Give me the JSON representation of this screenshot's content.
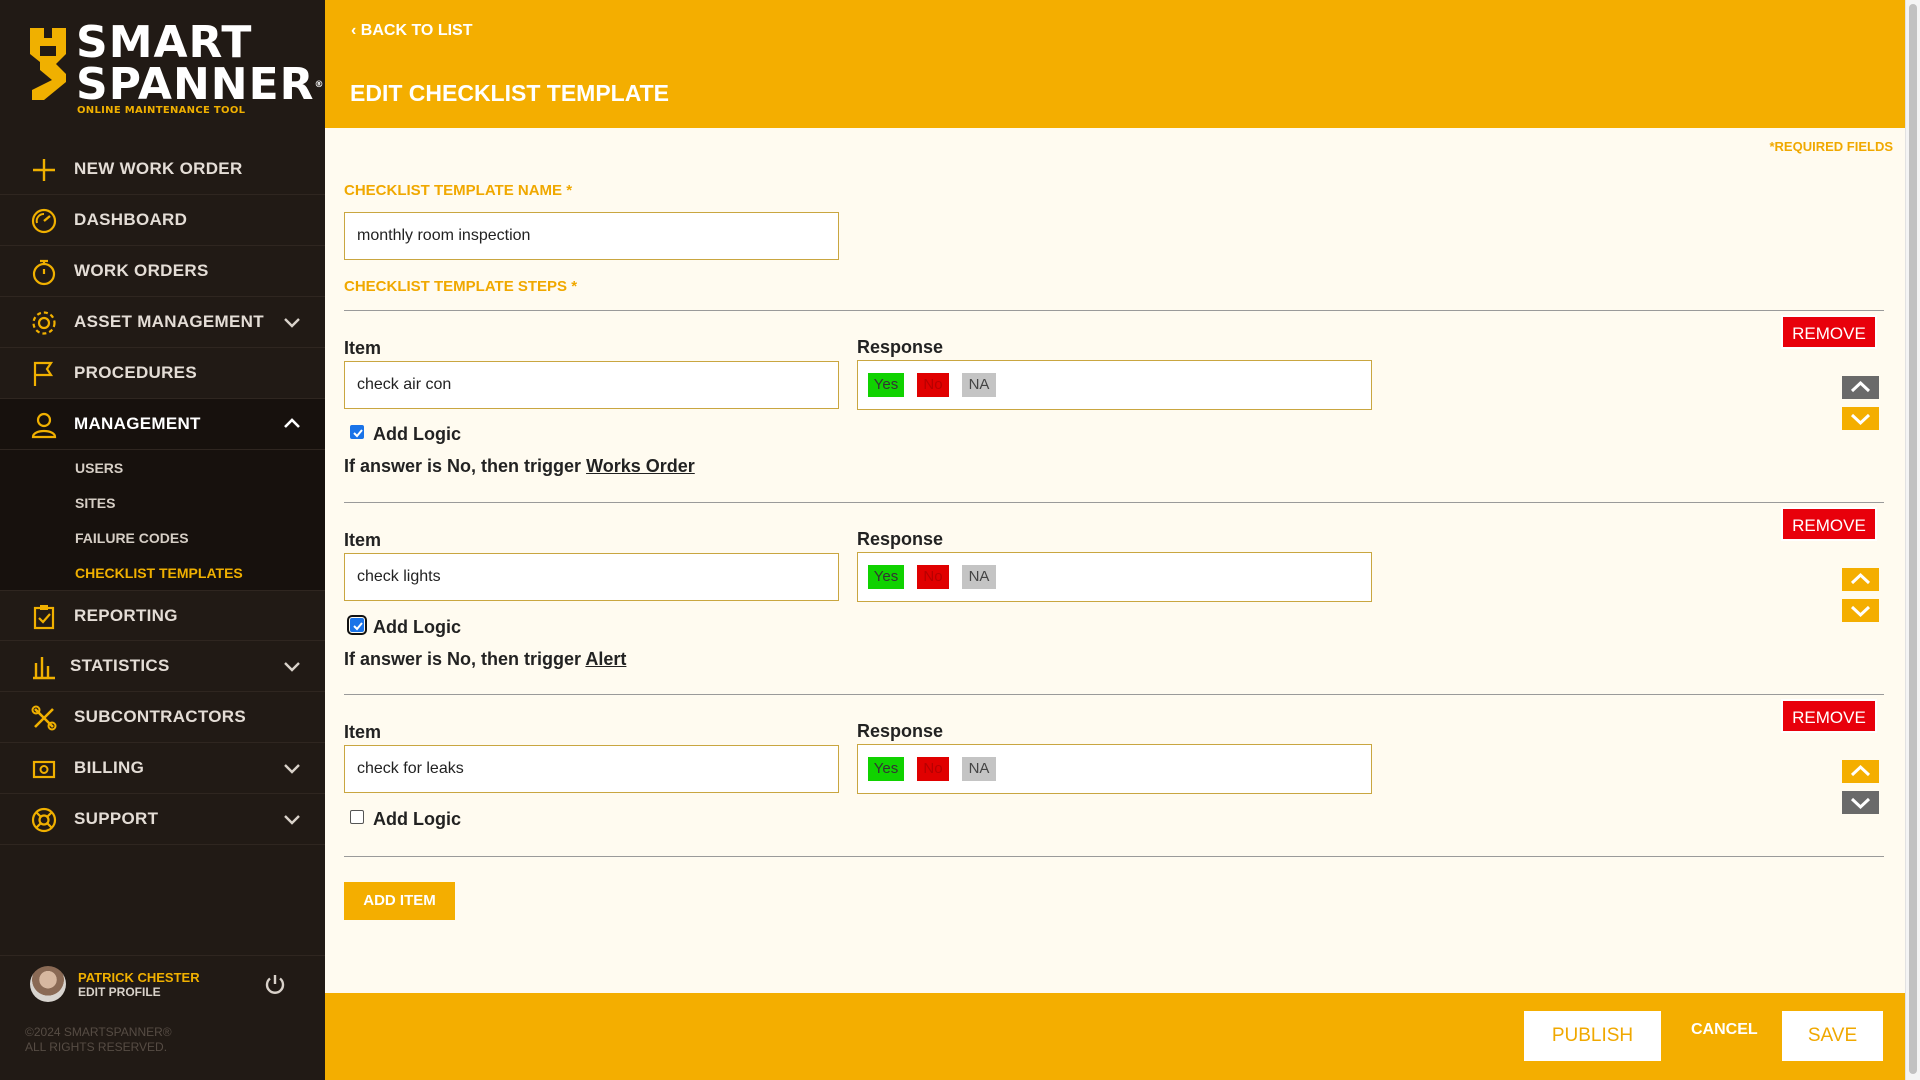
{
  "brand": {
    "line1": "SMART",
    "line2": "SPANNER",
    "reg": "®",
    "tagline": "ONLINE MAINTENANCE TOOL"
  },
  "nav": {
    "items": [
      {
        "label": "NEW WORK ORDER",
        "icon": "plus-icon"
      },
      {
        "label": "DASHBOARD",
        "icon": "gauge-icon"
      },
      {
        "label": "WORK ORDERS",
        "icon": "stopwatch-icon"
      },
      {
        "label": "ASSET MANAGEMENT",
        "icon": "gear-icon"
      },
      {
        "label": "PROCEDURES",
        "icon": "flag-icon"
      },
      {
        "label": "MANAGEMENT",
        "icon": "user-icon"
      },
      {
        "label": "REPORTING",
        "icon": "clipboard-check-icon"
      },
      {
        "label": "STATISTICS",
        "icon": "bar-chart-icon"
      },
      {
        "label": "SUBCONTRACTORS",
        "icon": "tools-icon"
      },
      {
        "label": "BILLING",
        "icon": "money-icon"
      },
      {
        "label": "SUPPORT",
        "icon": "lifebuoy-icon"
      }
    ],
    "management_sub": [
      "USERS",
      "SITES",
      "FAILURE CODES",
      "CHECKLIST TEMPLATES"
    ]
  },
  "user": {
    "name": "PATRICK CHESTER",
    "edit_label": "EDIT PROFILE"
  },
  "copyright": {
    "line1": "©2024 SMARTSPANNER®",
    "line2": "ALL RIGHTS RESERVED."
  },
  "header": {
    "back_label": "BACK TO LIST",
    "title": "EDIT CHECKLIST TEMPLATE"
  },
  "form": {
    "required_note": "*REQUIRED FIELDS",
    "name_label": "CHECKLIST TEMPLATE NAME *",
    "name_value": "monthly room inspection",
    "steps_label": "CHECKLIST TEMPLATE STEPS *",
    "item_label": "Item",
    "response_label": "Response",
    "add_logic_label": "Add Logic",
    "remove_label": "REMOVE",
    "logic_prefix": "If answer is No, then trigger",
    "options": {
      "yes": "Yes",
      "no": "No",
      "na": "NA"
    },
    "steps": [
      {
        "item": "check air con",
        "add_logic": true,
        "trigger": "Works Order"
      },
      {
        "item": "check lights",
        "add_logic": true,
        "trigger": "Alert"
      },
      {
        "item": "check for leaks",
        "add_logic": false,
        "trigger": ""
      }
    ],
    "add_item_label": "ADD ITEM"
  },
  "footer": {
    "publish_label": "PUBLISH",
    "cancel_label": "CANCEL",
    "save_label": "SAVE"
  },
  "colors": {
    "accent": "#f4ae00",
    "sidebar": "#211a15",
    "remove": "#e8000b",
    "yes": "#10d200",
    "no": "#e00000",
    "na": "#c4c4c4"
  }
}
